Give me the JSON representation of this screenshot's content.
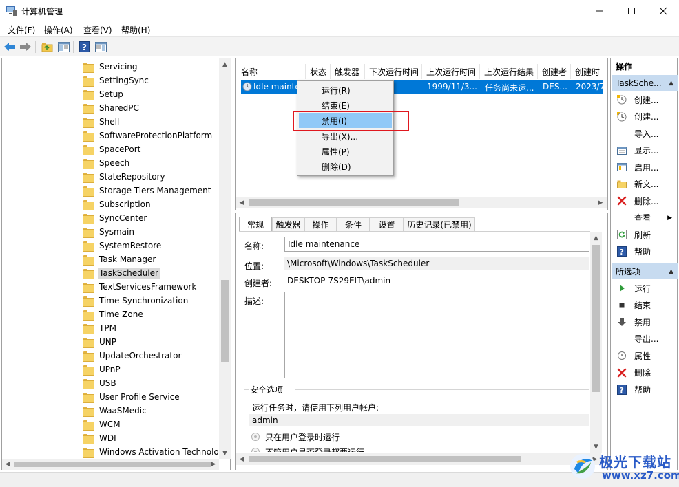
{
  "window": {
    "title": "计算机管理"
  },
  "menu": [
    "文件(F)",
    "操作(A)",
    "查看(V)",
    "帮助(H)"
  ],
  "tree": {
    "items": [
      "Servicing",
      "SettingSync",
      "Setup",
      "SharedPC",
      "Shell",
      "SoftwareProtectionPlatform",
      "SpacePort",
      "Speech",
      "StateRepository",
      "Storage Tiers Management",
      "Subscription",
      "SyncCenter",
      "Sysmain",
      "SystemRestore",
      "Task Manager",
      "TaskScheduler",
      "TextServicesFramework",
      "Time Synchronization",
      "Time Zone",
      "TPM",
      "UNP",
      "UpdateOrchestrator",
      "UPnP",
      "USB",
      "User Profile Service",
      "WaaSMedic",
      "WCM",
      "WDI",
      "Windows Activation Technolog"
    ],
    "selected": "TaskScheduler"
  },
  "task_table": {
    "columns": [
      "名称",
      "状态",
      "触发器",
      "下次运行时间",
      "上次运行时间",
      "上次运行结果",
      "创建者",
      "创建时"
    ],
    "row": {
      "name": "Idle mainte",
      "last_run": "1999/11/3...",
      "last_result": "任务尚未运...",
      "author": "DES...",
      "created": "2023/7"
    }
  },
  "context_menu": {
    "items": [
      "运行(R)",
      "结束(E)",
      "禁用(I)",
      "导出(X)...",
      "属性(P)",
      "删除(D)"
    ],
    "highlighted": "禁用(I)"
  },
  "details": {
    "tabs": [
      "常规",
      "触发器",
      "操作",
      "条件",
      "设置",
      "历史记录(已禁用)"
    ],
    "name_label": "名称:",
    "name_value": "Idle maintenance",
    "location_label": "位置:",
    "location_value": "\\Microsoft\\Windows\\TaskScheduler",
    "author_label": "创建者:",
    "author_value": "DESKTOP-7S29EIT\\admin",
    "description_label": "描述:",
    "security_title": "安全选项",
    "run_as_label": "运行任务时，请使用下列用户帐户:",
    "run_as_value": "admin",
    "option_1": "只在用户登录时运行",
    "option_2": "不管用户是否登录都要运行"
  },
  "actions": {
    "header": "操作",
    "section1_title": "TaskSche...",
    "section1_items": [
      {
        "label": "创建...",
        "icon": "create-basic-task-icon"
      },
      {
        "label": "创建...",
        "icon": "create-task-icon"
      },
      {
        "label": "导入...",
        "icon": ""
      },
      {
        "label": "显示...",
        "icon": "display-running-icon"
      },
      {
        "label": "启用...",
        "icon": "enable-history-icon"
      },
      {
        "label": "新文...",
        "icon": "new-folder-icon"
      },
      {
        "label": "删除...",
        "icon": "delete-icon"
      },
      {
        "label": "查看",
        "icon": ""
      },
      {
        "label": "刷新",
        "icon": "refresh-icon"
      },
      {
        "label": "帮助",
        "icon": "help-icon"
      }
    ],
    "section2_title": "所选项",
    "section2_items": [
      {
        "label": "运行",
        "icon": "run-icon"
      },
      {
        "label": "结束",
        "icon": "stop-icon"
      },
      {
        "label": "禁用",
        "icon": "disable-icon"
      },
      {
        "label": "导出...",
        "icon": ""
      },
      {
        "label": "属性",
        "icon": "properties-icon"
      },
      {
        "label": "删除",
        "icon": "delete-icon"
      },
      {
        "label": "帮助",
        "icon": "help-icon"
      }
    ]
  },
  "watermark": {
    "title": "极光下载站",
    "url": "www.xz7.com"
  },
  "colors": {
    "selection": "#0078d7",
    "menu_highlight": "#91c9f7",
    "callout": "#e0181f",
    "action_header": "#c7dbf0"
  }
}
